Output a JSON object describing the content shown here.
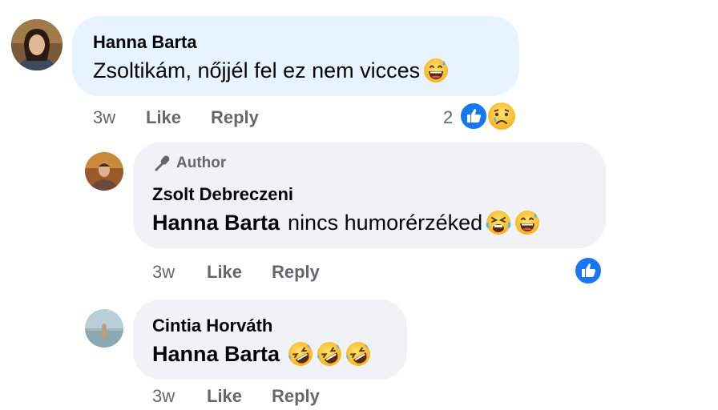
{
  "comments": [
    {
      "author": "Hanna Barta",
      "text": "Zsoltikám, nőjjél fel ez nem vicces",
      "emojis": [
        "laughing-with-sweat-emoji"
      ],
      "time": "3w",
      "like_label": "Like",
      "reply_label": "Reply",
      "reaction_count": "2",
      "reactions": [
        "like-reaction-icon",
        "sad-reaction-icon"
      ]
    },
    {
      "badge": "Author",
      "author": "Zsolt Debreczeni",
      "mention": "Hanna Barta",
      "text": "nincs humorérzéked",
      "emojis": [
        "tired-face-emoji",
        "laughing-with-sweat-emoji"
      ],
      "time": "3w",
      "like_label": "Like",
      "reply_label": "Reply",
      "reactions": [
        "like-reaction-icon"
      ]
    },
    {
      "author": "Cintia Horváth",
      "mention": "Hanna Barta",
      "emojis": [
        "rolling-on-floor-laughing-emoji",
        "rolling-on-floor-laughing-emoji",
        "rolling-on-floor-laughing-emoji"
      ],
      "time": "3w",
      "like_label": "Like",
      "reply_label": "Reply"
    }
  ],
  "colors": {
    "first_bubble": "#e7f3ff",
    "reply_bubble": "#f0f2f5",
    "meta_text": "#65676b",
    "like_blue": "#1877f2"
  }
}
